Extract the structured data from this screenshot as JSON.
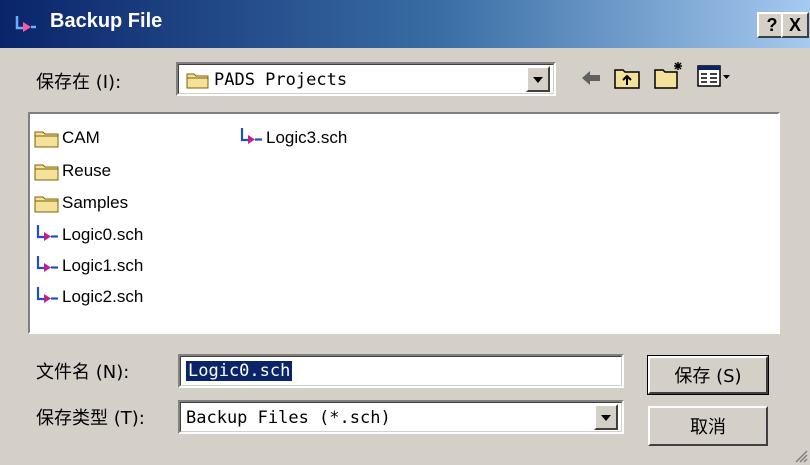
{
  "window": {
    "title": "Backup File",
    "help_label": "?",
    "close_label": "X"
  },
  "save_in": {
    "label": "保存在 (I):",
    "value": "PADS Projects"
  },
  "files": [
    {
      "name": "CAM",
      "type": "folder"
    },
    {
      "name": "Reuse",
      "type": "folder"
    },
    {
      "name": "Samples",
      "type": "folder"
    },
    {
      "name": "Logic0.sch",
      "type": "sch"
    },
    {
      "name": "Logic1.sch",
      "type": "sch"
    },
    {
      "name": "Logic2.sch",
      "type": "sch"
    },
    {
      "name": "Logic3.sch",
      "type": "sch"
    }
  ],
  "file_name": {
    "label": "文件名 (N):",
    "value": "Logic0.sch"
  },
  "file_type": {
    "label": "保存类型 (T):",
    "value": "Backup Files (*.sch)"
  },
  "buttons": {
    "save": "保存 (S)",
    "cancel": "取消"
  },
  "icons": {
    "title": "pads-logic-icon",
    "back": "back-arrow-icon",
    "up": "up-folder-icon",
    "new_folder": "new-folder-icon",
    "view": "view-menu-icon"
  },
  "colors": {
    "title_gradient_start": "#0a246a",
    "title_gradient_end": "#a6caf0",
    "face": "#d4d0c8",
    "selection": "#0a246a",
    "folder": "#f4e29a",
    "sch_icon": "#1e4fc7",
    "sch_arrow": "#c0208a"
  }
}
